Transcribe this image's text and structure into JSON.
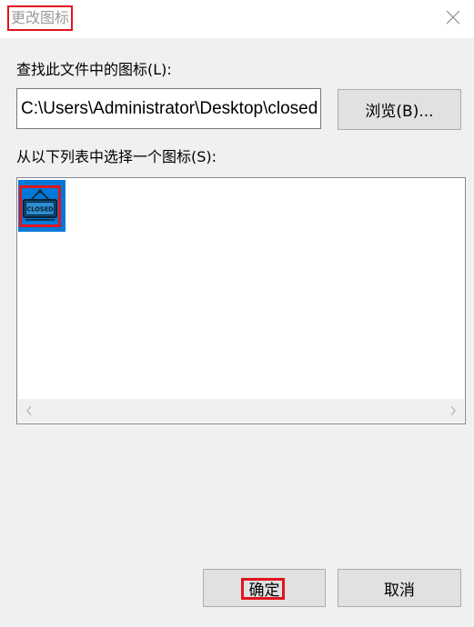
{
  "dialog": {
    "title": "更改图标"
  },
  "file": {
    "label": "查找此文件中的图标(L):",
    "path": "C:\\Users\\Administrator\\Desktop\\closed",
    "browse_label": "浏览(B)..."
  },
  "icons": {
    "label": "从以下列表中选择一个图标(S):",
    "items": [
      {
        "name": "closed-sign-icon",
        "text": "CLOSED",
        "selected": true
      }
    ]
  },
  "buttons": {
    "ok_label": "确定",
    "cancel_label": "取消"
  },
  "colors": {
    "selection": "#0078d7",
    "highlight_border": "#e0141e"
  }
}
